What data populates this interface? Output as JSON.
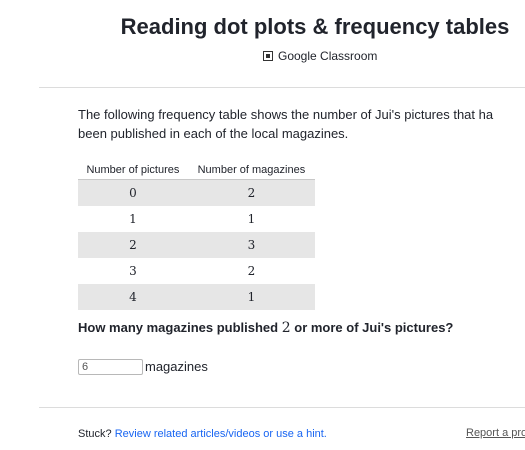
{
  "header": {
    "title": "Reading dot plots & frequency tables",
    "classroom_label": "Google Classroom",
    "classroom_icon": "google-classroom-icon"
  },
  "problem": {
    "intro_line1": "The following frequency table shows the number of Jui's pictures that ha",
    "intro_line2": "been published in each of the local magazines.",
    "table": {
      "headers": [
        "Number of pictures",
        "Number of magazines"
      ],
      "rows": [
        [
          "0",
          "2"
        ],
        [
          "1",
          "1"
        ],
        [
          "2",
          "3"
        ],
        [
          "3",
          "2"
        ],
        [
          "4",
          "1"
        ]
      ]
    },
    "question_before": "How many magazines published ",
    "question_number": "2",
    "question_after": " or more of Jui's pictures?",
    "answer_value": "6",
    "answer_unit": "magazines"
  },
  "footer": {
    "stuck_label": "Stuck?",
    "hint_link": "Review related articles/videos or use a hint.",
    "report_link": "Report a pro"
  }
}
